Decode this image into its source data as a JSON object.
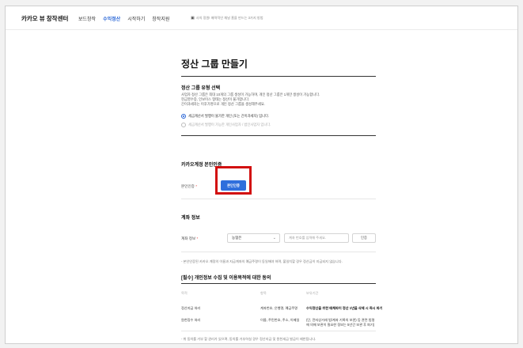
{
  "topbar": {
    "logo": "카카오 뷰 창작센터",
    "nav": [
      "보드창작",
      "수익정산",
      "시작하기",
      "창작지원"
    ],
    "active_nav_index": 1,
    "notice": "사의 정원! 매력적인 채널 홈을 만드는 3가지 방법"
  },
  "page": {
    "title": "정산 그룹 만들기"
  },
  "group_type": {
    "title": "정산 그룹 유형 선택",
    "desc": [
      "사업자 정산 그룹은 최대 10개의 그룹 생성이 가능하며, 개인 정산 그룹은 1개만 생성이 가능합니다.",
      "현금영수증, 인보이스 형태는 정산이 불가합니다.",
      "간이과세자는 이후가명으로 개인 정산 그룹을 생성해주세요."
    ],
    "options": [
      {
        "label": "세금계산서 발행이 불가한 개인 (또는 간이과세자) 입니다.",
        "checked": true
      },
      {
        "label": "세금계산서 발행이 가능한 개인사업자 / 법인사업자 입니다.",
        "checked": false
      }
    ]
  },
  "verify": {
    "title": "카카오계정 본인인증",
    "label": "본인인증",
    "required_mark": "*",
    "button": "본인인증"
  },
  "account": {
    "title": "계좌 정보",
    "label": "계좌 정보",
    "required_mark": "*",
    "bank_selected": "농협은",
    "account_placeholder": "계좌 번호를 입력해 주세요.",
    "confirm_button": "인증",
    "note": "- 본인인증된 카카오 계정의 이름과 지급계좌의 예금주명이 동일해야 하며, 불일치할 경우 정산금이 지급되지 않습니다."
  },
  "consent": {
    "title": "[필수] 개인정보 수집 및 이용목적에 대한 동의",
    "headers": [
      "목적",
      "항목",
      "보유기간"
    ],
    "rows": [
      {
        "purpose": "정산지급 처리",
        "items": "계좌번호, 은행명, 예금주명",
        "period": "수익정산을 위한 매체파이 정산 1년을 삭제 시 즉시 파기"
      },
      {
        "purpose": "원천징수 처리",
        "items": "이름, 주민번호, 주소, 이메일",
        "period": "(단, 전자상거래 법/계좌 기록의 보관) 등 관련 법령에 의해 보관이 필요한 정보는 5년간 보관 후 파기)"
      }
    ],
    "note": "- 위 동의를 거부 할 권리가 있으며, 동의를 거부하실 경우 정산지급 및 원천세금 발급이 제한됩니다."
  }
}
